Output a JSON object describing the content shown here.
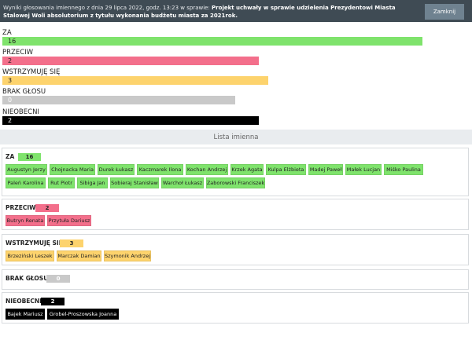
{
  "header": {
    "prefix": "Wyniki głosowania imiennego z dnia 29 lipca 2022, godz. 13:23 w sprawie: ",
    "subject": "Projekt uchwały w sprawie udzielenia Prezydentowi Miasta Stalowej Woli absolutorium z tytułu wykonania budżetu miasta za 2021rok.",
    "close_label": "Zamknij"
  },
  "summary": [
    {
      "label": "ZA",
      "value": "16"
    },
    {
      "label": "PRZECIW",
      "value": "2"
    },
    {
      "label": "WSTRZYMUJĘ SIĘ",
      "value": "3"
    },
    {
      "label": "BRAK GŁOSU",
      "value": "0"
    },
    {
      "label": "NIEOBECNI",
      "value": "2"
    }
  ],
  "list_title": "Lista imienna",
  "groups": [
    {
      "title": "ZA",
      "count": "16",
      "names": [
        "Augustyn Jerzy",
        "Chojnacka Maria",
        "Durek Łukasz",
        "Kaczmarek Ilona",
        "Kochan Andrzej",
        "Krzek Agata",
        "Kulpa Elżbieta",
        "Madej Paweł",
        "Małek Lucjan",
        "Miśko Paulina",
        "Paleń Karolina",
        "Rut Piotr",
        "Sibiga Jan",
        "Sobieraj Stanisław",
        "Warchoł Łukasz",
        "Zaborowski Franciszek"
      ]
    },
    {
      "title": "PRZECIW",
      "count": "2",
      "names": [
        "Butryn Renata",
        "Przytuła Dariusz"
      ]
    },
    {
      "title": "WSTRZYMUJĘ SIĘ",
      "count": "3",
      "names": [
        "Brzeziński Leszek",
        "Marczak Damian",
        "Szymonik Andrzej"
      ]
    },
    {
      "title": "BRAK GŁOSU",
      "count": "0",
      "names": []
    },
    {
      "title": "NIEOBECNI",
      "count": "2",
      "names": [
        "Bajek Mariusz",
        "Grobel-Proszowska Joanna"
      ]
    }
  ],
  "colors": {
    "za": "#7fe36c",
    "przeciw": "#f36f8b",
    "wstrzymuje": "#fdd36d",
    "brak": "#c9c9c9",
    "nieobecni": "#000000"
  }
}
